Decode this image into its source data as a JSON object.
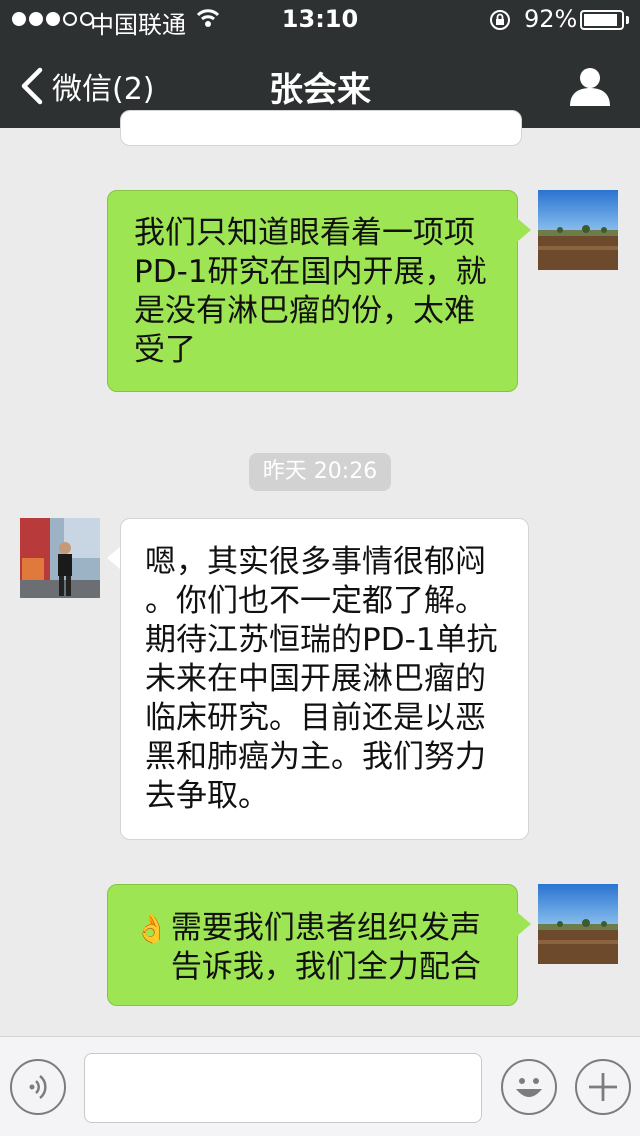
{
  "status_bar": {
    "carrier": "中国联通",
    "time": "13:10",
    "battery_percent": "92%",
    "battery_level": 0.92,
    "signal_strength_of_5": 3
  },
  "nav": {
    "back_label": "微信(2)",
    "title": "张会来"
  },
  "messages": [
    {
      "sender": "me",
      "text": "我们只知道眼看着一项项\nPD-1研究在国内开展，就\n是没有淋巴瘤的份，太难\n受了"
    },
    {
      "sender": "other",
      "text": "嗯，其实很多事情很郁闷\n。你们也不一定都了解。\n期待江苏恒瑞的PD-1单抗\n未来在中国开展淋巴瘤的\n临床研究。目前还是以恶\n黑和肺癌为主。我们努力\n去争取。"
    },
    {
      "sender": "me",
      "emoji": "👌",
      "text": "需要我们患者组织发声\n告诉我，我们全力配合"
    }
  ],
  "timestamp": "昨天 20:26",
  "colors": {
    "nav_bg": "#2e3132",
    "my_bubble": "#9ee553",
    "their_bubble": "#ffffff",
    "chat_bg": "#ebebeb"
  },
  "icons": {
    "back": "chevron-left-icon",
    "profile": "person-icon",
    "voice": "voice-icon",
    "emoji": "smiley-icon",
    "more": "plus-icon"
  }
}
